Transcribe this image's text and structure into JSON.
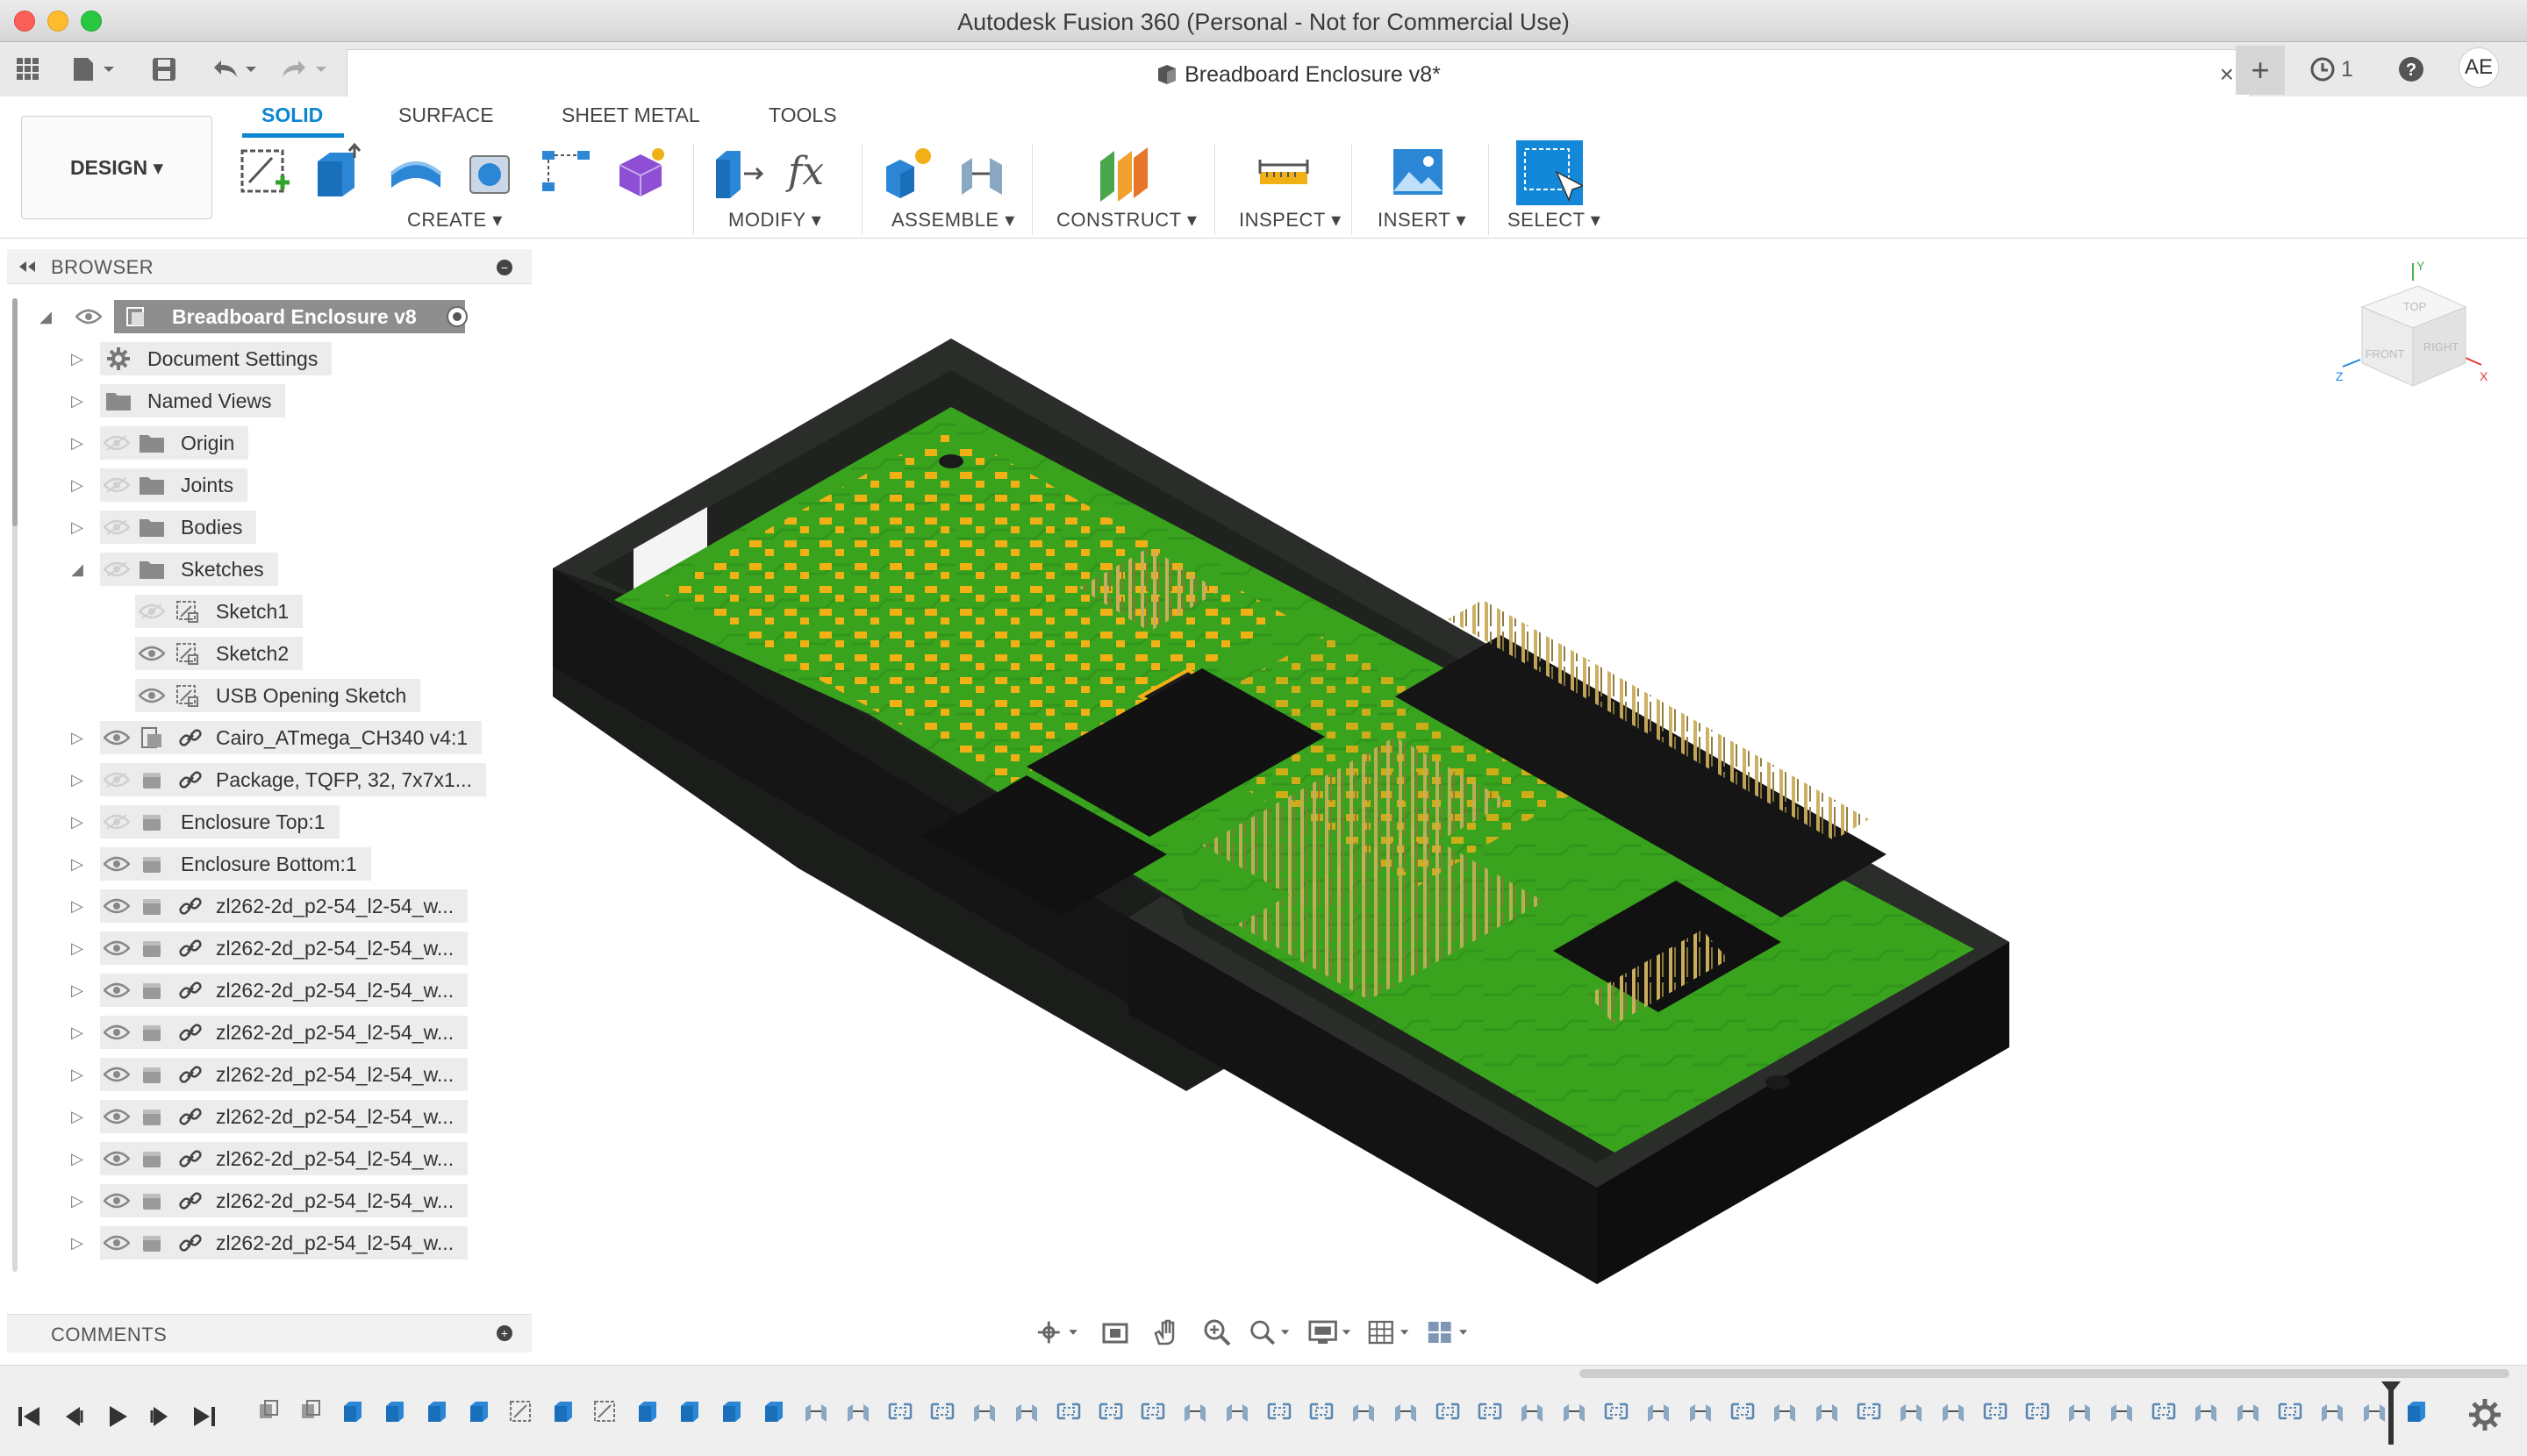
{
  "window": {
    "title": "Autodesk Fusion 360 (Personal - Not for Commercial Use)"
  },
  "document_tab": {
    "title": "Breadboard Enclosure v8*",
    "close": "×"
  },
  "app_toolbar": {
    "jobs_count": "1",
    "user_initials": "AE",
    "new_tab": "+"
  },
  "ribbon": {
    "workspace": "DESIGN ▾",
    "tabs": [
      "SOLID",
      "SURFACE",
      "SHEET METAL",
      "TOOLS"
    ],
    "active_tab": "SOLID",
    "groups": {
      "create": "CREATE ▾",
      "modify": "MODIFY ▾",
      "assemble": "ASSEMBLE ▾",
      "construct": "CONSTRUCT ▾",
      "inspect": "INSPECT ▾",
      "insert": "INSERT ▾",
      "select": "SELECT ▾"
    }
  },
  "browser": {
    "title": "BROWSER",
    "root": "Breadboard Enclosure v8",
    "items": [
      "Document Settings",
      "Named Views",
      "Origin",
      "Joints",
      "Bodies",
      "Sketches",
      "Sketch1",
      "Sketch2",
      "USB Opening Sketch",
      "Cairo_ATmega_CH340 v4:1",
      "Package, TQFP, 32, 7x7x1...",
      "Enclosure Top:1",
      "Enclosure Bottom:1",
      "zl262-2d_p2-54_l2-54_w...",
      "zl262-2d_p2-54_l2-54_w...",
      "zl262-2d_p2-54_l2-54_w...",
      "zl262-2d_p2-54_l2-54_w...",
      "zl262-2d_p2-54_l2-54_w...",
      "zl262-2d_p2-54_l2-54_w...",
      "zl262-2d_p2-54_l2-54_w...",
      "zl262-2d_p2-54_l2-54_w...",
      "zl262-2d_p2-54_l2-54_w..."
    ]
  },
  "comments": {
    "title": "COMMENTS"
  },
  "viewcube": {
    "top": "TOP",
    "front": "FRONT",
    "right": "RIGHT",
    "axis_x": "X",
    "axis_y": "Y",
    "axis_z": "Z"
  },
  "colors": {
    "accent": "#0b86d1",
    "enclosure": "#222522",
    "pcb": "#3aa31e",
    "pads": "#f2b017",
    "pins": "#b39a4e",
    "headers": "#1a1a1a"
  }
}
